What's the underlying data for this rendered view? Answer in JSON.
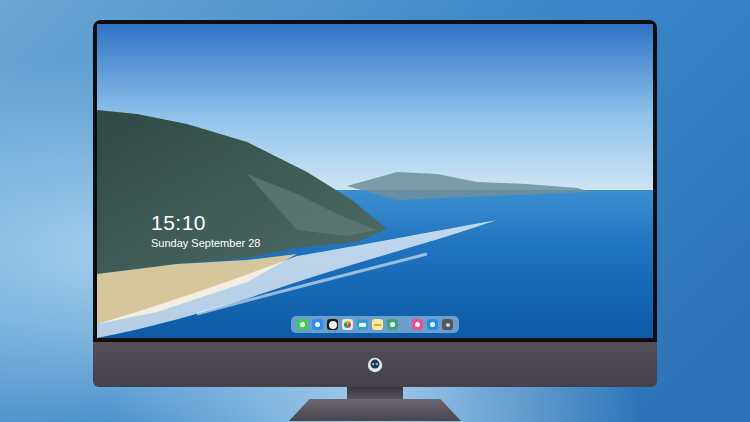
{
  "lock_screen": {
    "time": "15:10",
    "date": "Sunday September 28"
  },
  "dock": {
    "items": [
      {
        "kind": "messages"
      },
      {
        "kind": "files"
      },
      {
        "kind": "clock"
      },
      {
        "kind": "photos"
      },
      {
        "kind": "video"
      },
      {
        "kind": "notes"
      },
      {
        "kind": "gallery"
      },
      {
        "kind": "separator"
      },
      {
        "kind": "music"
      },
      {
        "kind": "appstore"
      },
      {
        "kind": "camera"
      }
    ]
  }
}
